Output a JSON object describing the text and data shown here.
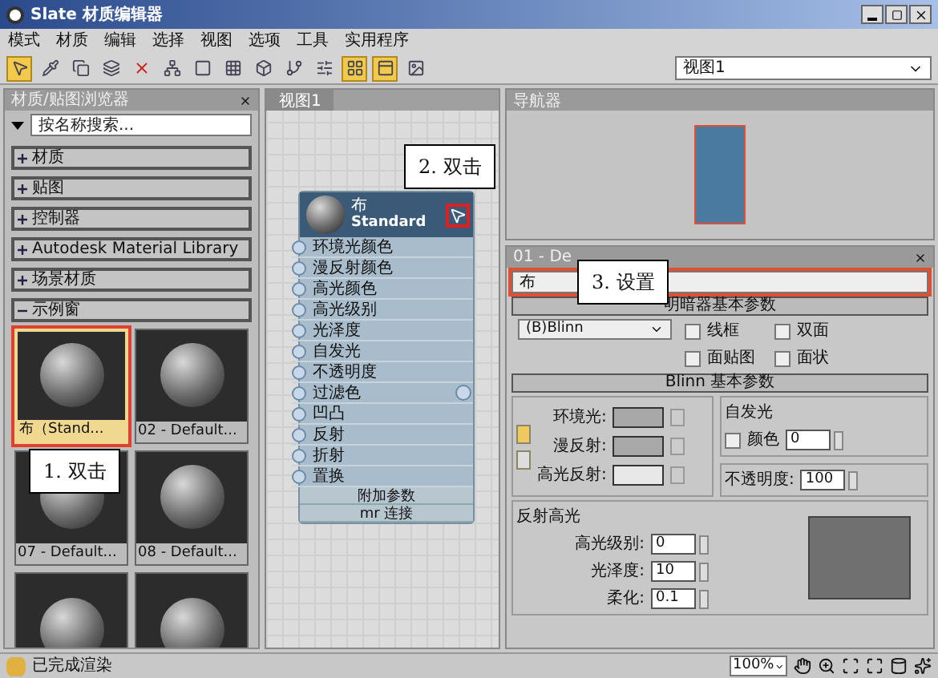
{
  "window": {
    "title": "Slate 材质编辑器"
  },
  "menu": [
    "模式",
    "材质",
    "编辑",
    "选择",
    "视图",
    "选项",
    "工具",
    "实用程序"
  ],
  "toolbar": [
    {
      "selected": true
    },
    {
      "selected": false
    },
    {
      "selected": false
    },
    {
      "selected": false
    },
    {
      "selected": false
    },
    {
      "selected": false
    },
    {
      "selected": false
    },
    {
      "selected": false
    },
    {
      "selected": false
    },
    {
      "selected": false
    },
    {
      "selected": false
    },
    {
      "selected": true
    },
    {
      "selected": true
    },
    {
      "selected": false
    }
  ],
  "view_select": "视图1",
  "browser": {
    "title": "材质/贴图浏览器",
    "search": {
      "placeholder": "按名称搜索..."
    },
    "groups": [
      {
        "label": "材质",
        "expanded": false
      },
      {
        "label": "贴图",
        "expanded": false
      },
      {
        "label": "控制器",
        "expanded": false
      },
      {
        "label": "Autodesk Material Library",
        "expanded": false
      },
      {
        "label": "场景材质",
        "expanded": false
      },
      {
        "label": "示例窗",
        "expanded": true
      }
    ],
    "samples": [
      {
        "label": "布（Stand...",
        "selected": true
      },
      {
        "label": "02 - Default...",
        "selected": false
      },
      {
        "label": "07 - Default...",
        "selected": false
      },
      {
        "label": "08 - Default...",
        "selected": false
      },
      {
        "selected": false
      },
      {
        "selected": false
      }
    ]
  },
  "canvas": {
    "tab": "视图1",
    "node": {
      "name": "布",
      "type": "Standard",
      "slots": [
        "环境光颜色",
        "漫反射颜色",
        "高光颜色",
        "高光级别",
        "光泽度",
        "自发光",
        "不透明度",
        "过滤色",
        "凹凸",
        "反射",
        "折射",
        "置换"
      ],
      "footer": [
        "附加参数",
        "mr 连接"
      ]
    }
  },
  "navigator": {
    "title": "导航器"
  },
  "params": {
    "title": "01 - De",
    "name": "布",
    "shader": {
      "heading": "明暗器基本参数",
      "value": "(B)Blinn",
      "options": [
        {
          "label": "线框",
          "checked": false
        },
        {
          "label": "双面",
          "checked": false
        },
        {
          "label": "面贴图",
          "checked": false
        },
        {
          "label": "面状",
          "checked": false
        }
      ]
    },
    "blinn": {
      "heading": "Blinn 基本参数",
      "colors": [
        {
          "label": "环境光:",
          "color": "#a8a8a8"
        },
        {
          "label": "漫反射:",
          "color": "#a8a8a8"
        },
        {
          "label": "高光反射:",
          "color": "#e8e8e8"
        }
      ],
      "self_illum": {
        "label": "自发光",
        "color_label": "颜色",
        "checked": false,
        "value": "0"
      },
      "opacity": {
        "label": "不透明度:",
        "value": "100"
      }
    },
    "specular": {
      "heading": "反射高光",
      "fields": [
        {
          "label": "高光级别:",
          "value": "0"
        },
        {
          "label": "光泽度:",
          "value": "10"
        },
        {
          "label": "柔化:",
          "value": "0.1"
        }
      ]
    }
  },
  "annotations": [
    "1. 双击",
    "2. 双击",
    "3. 设置"
  ],
  "status_bar": {
    "text": "已完成渲染",
    "zoom": "100%"
  }
}
